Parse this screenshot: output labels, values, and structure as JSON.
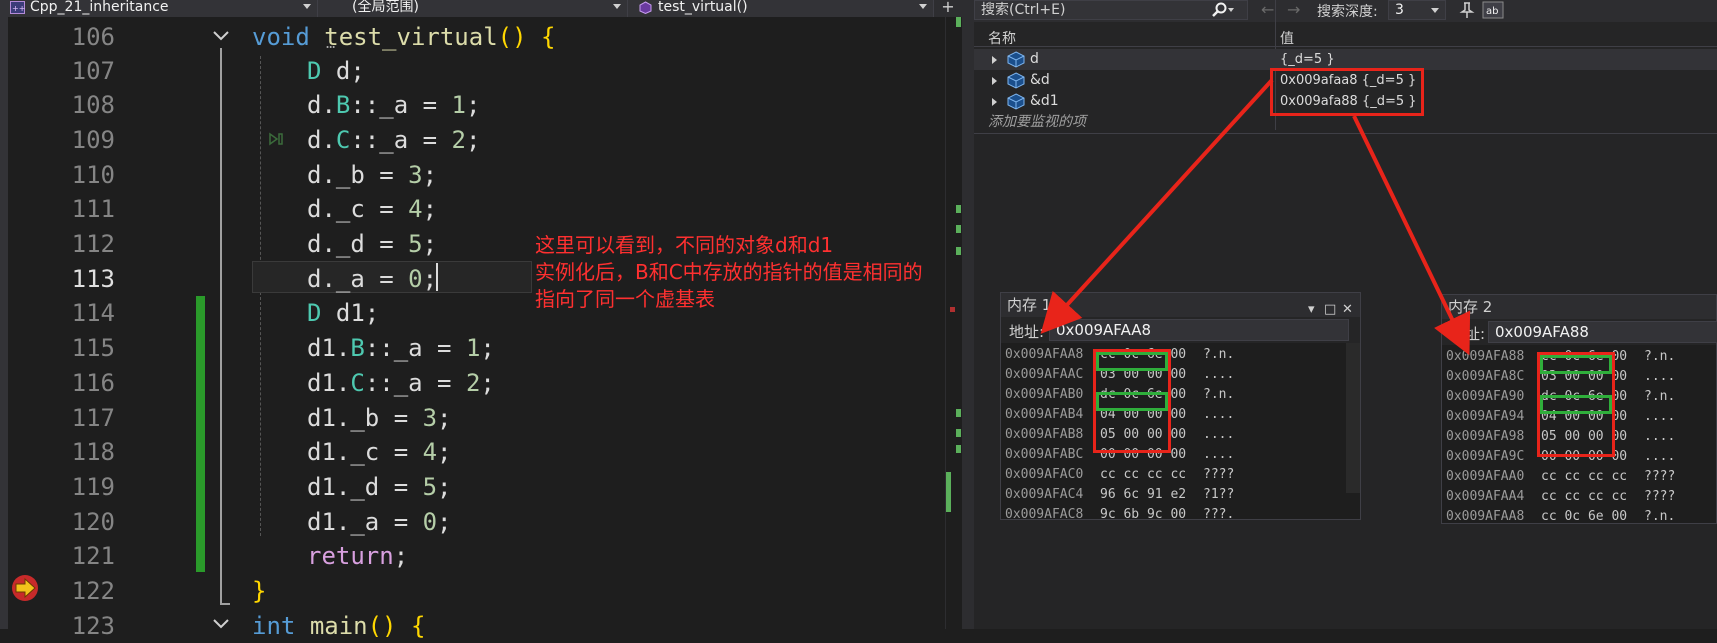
{
  "nav_bar": {
    "project": "Cpp_21_inheritance",
    "scope": "(全局范围)",
    "function": "test_virtual()",
    "plus": "+"
  },
  "editor": {
    "lines": [
      {
        "num": "106"
      },
      {
        "num": "107"
      },
      {
        "num": "108"
      },
      {
        "num": "109"
      },
      {
        "num": "110"
      },
      {
        "num": "111"
      },
      {
        "num": "112"
      },
      {
        "num": "113"
      },
      {
        "num": "114"
      },
      {
        "num": "115"
      },
      {
        "num": "116"
      },
      {
        "num": "117"
      },
      {
        "num": "118"
      },
      {
        "num": "119"
      },
      {
        "num": "120"
      },
      {
        "num": "121"
      },
      {
        "num": "122"
      },
      {
        "num": "123"
      }
    ],
    "code": {
      "l106": {
        "kw": "void",
        "fn": "test_virtual",
        "rest": "() {"
      },
      "l107": {
        "ty": "D",
        "rest": " d;"
      },
      "l108": {
        "pre": "d.",
        "ty": "B",
        "mid": "::_a = ",
        "num": "1",
        "post": ";"
      },
      "l109": {
        "pre": "d.",
        "ty": "C",
        "mid": "::_a = ",
        "num": "2",
        "post": ";"
      },
      "l110": {
        "pre": "d._b = ",
        "num": "3",
        "post": ";"
      },
      "l111": {
        "pre": "d._c = ",
        "num": "4",
        "post": ";"
      },
      "l112": {
        "pre": "d._d = ",
        "num": "5",
        "post": ";"
      },
      "l113": {
        "pre": "d._a = ",
        "num": "0",
        "post": ";"
      },
      "l114": {
        "ty": "D",
        "rest": " d1;"
      },
      "l115": {
        "pre": "d1.",
        "ty": "B",
        "mid": "::_a = ",
        "num": "1",
        "post": ";"
      },
      "l116": {
        "pre": "d1.",
        "ty": "C",
        "mid": "::_a = ",
        "num": "2",
        "post": ";"
      },
      "l117": {
        "pre": "d1._b = ",
        "num": "3",
        "post": ";"
      },
      "l118": {
        "pre": "d1._c = ",
        "num": "4",
        "post": ";"
      },
      "l119": {
        "pre": "d1._d = ",
        "num": "5",
        "post": ";"
      },
      "l120": {
        "pre": "d1._a = ",
        "num": "0",
        "post": ";"
      },
      "l121": {
        "ret": "return",
        "post": ";"
      },
      "l122": {
        "br": "}"
      },
      "l123": {
        "kw": "int",
        "fn": "main",
        "rest": "() {"
      }
    },
    "ellipsis": "...",
    "annotation": [
      "这里可以看到，不同的对象d和d1",
      "实例化后，B和C中存放的指针的值是相同的",
      "指向了同一个虚基表"
    ],
    "colors": {
      "annotation": "#ff3030",
      "change_bar": "#2a9a2a"
    }
  },
  "watch": {
    "search_placeholder": "搜索(Ctrl+E)",
    "nav_back": "←",
    "nav_forward": "→",
    "depth_label": "搜索深度:",
    "depth_value": "3",
    "columns": {
      "name": "名称",
      "value": "值"
    },
    "rows": [
      {
        "name": "d",
        "value": "{_d=5 }"
      },
      {
        "name": "&d",
        "value": "0x009afaa8 {_d=5 }"
      },
      {
        "name": "&d1",
        "value": "0x009afa88 {_d=5 }"
      }
    ],
    "add_watch": "添加要监视的项"
  },
  "memory1": {
    "title": "内存 1",
    "addr_label": "地址:",
    "addr_value": "0x009AFAA8",
    "rows": [
      {
        "addr": "0x009AFAA8",
        "bytes": "cc 0c 6e 00",
        "chars": "?.n."
      },
      {
        "addr": "0x009AFAAC",
        "bytes": "03 00 00 00",
        "chars": "...."
      },
      {
        "addr": "0x009AFAB0",
        "bytes": "dc 0c 6e 00",
        "chars": "?.n."
      },
      {
        "addr": "0x009AFAB4",
        "bytes": "04 00 00 00",
        "chars": "...."
      },
      {
        "addr": "0x009AFAB8",
        "bytes": "05 00 00 00",
        "chars": "...."
      },
      {
        "addr": "0x009AFABC",
        "bytes": "00 00 00 00",
        "chars": "...."
      },
      {
        "addr": "0x009AFAC0",
        "bytes": "cc cc cc cc",
        "chars": "????"
      },
      {
        "addr": "0x009AFAC4",
        "bytes": "96 6c 91 e2",
        "chars": "?1??"
      },
      {
        "addr": "0x009AFAC8",
        "bytes": "9c 6b 9c 00",
        "chars": "???."
      }
    ]
  },
  "memory2": {
    "title": "内存 2",
    "addr_label": "地址:",
    "addr_value": "0x009AFA88",
    "rows": [
      {
        "addr": "0x009AFA88",
        "bytes": "cc 0c 6e 00",
        "chars": "?.n."
      },
      {
        "addr": "0x009AFA8C",
        "bytes": "03 00 00 00",
        "chars": "...."
      },
      {
        "addr": "0x009AFA90",
        "bytes": "dc 0c 6e 00",
        "chars": "?.n."
      },
      {
        "addr": "0x009AFA94",
        "bytes": "04 00 00 00",
        "chars": "...."
      },
      {
        "addr": "0x009AFA98",
        "bytes": "05 00 00 00",
        "chars": "...."
      },
      {
        "addr": "0x009AFA9C",
        "bytes": "00 00 00 00",
        "chars": "...."
      },
      {
        "addr": "0x009AFAA0",
        "bytes": "cc cc cc cc",
        "chars": "????"
      },
      {
        "addr": "0x009AFAA4",
        "bytes": "cc cc cc cc",
        "chars": "????"
      },
      {
        "addr": "0x009AFAA8",
        "bytes": "cc 0c 6e 00",
        "chars": "?.n."
      }
    ]
  },
  "icons": {
    "project": "cpp-project-icon",
    "function": "function-cube-icon",
    "search": "search-icon",
    "pin": "pin-icon",
    "hex": "hex-display-icon",
    "next_statement": "next-statement-arrow-icon",
    "watch_object": "object-cube-icon"
  }
}
